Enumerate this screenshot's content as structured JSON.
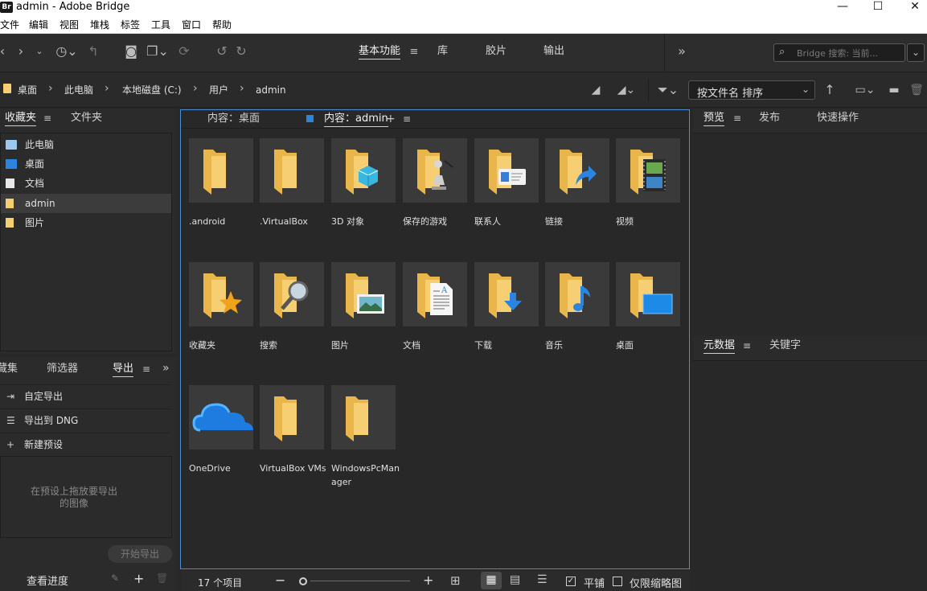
{
  "window": {
    "app_icon": "Br",
    "title": "admin - Adobe Bridge",
    "minimize": "—",
    "maximize": "☐",
    "close": "✕"
  },
  "menu": [
    "文件",
    "编辑",
    "视图",
    "堆栈",
    "标签",
    "工具",
    "窗口",
    "帮助"
  ],
  "workspaces": {
    "items": [
      "基本功能",
      "库",
      "胶片",
      "输出"
    ],
    "active": "基本功能",
    "more": "»"
  },
  "search": {
    "placeholder": "Bridge 搜索: 当前..."
  },
  "breadcrumb": [
    "桌面",
    "此电脑",
    "本地磁盘 (C:)",
    "用户",
    "admin"
  ],
  "sort": {
    "value": "按文件名 排序"
  },
  "left_top": {
    "tabs": [
      "收藏夹",
      "文件夹"
    ],
    "items": [
      {
        "label": "此电脑",
        "icon": "computer-icon"
      },
      {
        "label": "桌面",
        "icon": "desktop-icon"
      },
      {
        "label": "文档",
        "icon": "document-icon"
      },
      {
        "label": "admin",
        "icon": "folder-icon"
      },
      {
        "label": "图片",
        "icon": "pictures-icon"
      }
    ],
    "selected": "admin"
  },
  "left_bottom": {
    "tabs": [
      "收集",
      "筛选器",
      "导出"
    ],
    "truncated_first_tab": "藏集",
    "more": "»",
    "items": [
      {
        "label": "自定导出",
        "icon": "export-icon"
      },
      {
        "label": "导出到 DNG",
        "icon": "list-icon"
      },
      {
        "label": "新建预设",
        "icon": "plus-icon"
      }
    ],
    "drop_hint_line1": "在预设上拖放要导出",
    "drop_hint_line2": "的图像",
    "start_export": "开始导出",
    "view_progress": "查看进度"
  },
  "content": {
    "tabs": [
      "内容：桌面",
      "内容：admin"
    ],
    "items": [
      {
        "label": ".android",
        "type": "folder"
      },
      {
        "label": ".VirtualBox",
        "type": "folder"
      },
      {
        "label": "3D 对象",
        "type": "3d"
      },
      {
        "label": "保存的游戏",
        "type": "games"
      },
      {
        "label": "联系人",
        "type": "contacts"
      },
      {
        "label": "链接",
        "type": "links"
      },
      {
        "label": "视频",
        "type": "videos"
      },
      {
        "label": "收藏夹",
        "type": "favorites"
      },
      {
        "label": "搜索",
        "type": "search"
      },
      {
        "label": "图片",
        "type": "pictures"
      },
      {
        "label": "文档",
        "type": "documents"
      },
      {
        "label": "下载",
        "type": "downloads"
      },
      {
        "label": "音乐",
        "type": "music"
      },
      {
        "label": "桌面",
        "type": "desktop"
      },
      {
        "label": "OneDrive",
        "type": "onedrive"
      },
      {
        "label": "VirtualBox VMs",
        "type": "folder"
      },
      {
        "label": "WindowsPcManager",
        "type": "folder"
      }
    ]
  },
  "status": {
    "count": "17 个项目",
    "tile_option": "平铺",
    "thumb_only_option": "仅限缩略图",
    "tile_checked": true,
    "thumb_only_checked": false
  },
  "right_top": {
    "tabs": [
      "预览",
      "发布",
      "快速操作"
    ]
  },
  "right_bottom": {
    "tabs": [
      "元数据",
      "关键字"
    ]
  },
  "colors": {
    "folder": "#f5cf72",
    "folder_dark": "#e8b64a",
    "accent_blue": "#2b84e0",
    "panel": "#2b2b2b"
  }
}
